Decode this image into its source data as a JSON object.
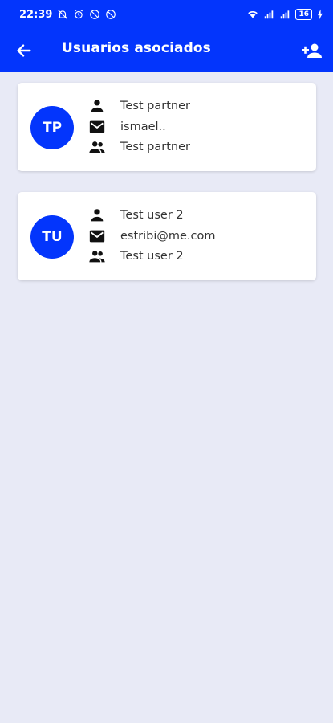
{
  "status": {
    "time": "22:39",
    "battery": "16"
  },
  "appbar": {
    "title": "Usuarios asociados"
  },
  "users": [
    {
      "initials": "TP",
      "name": "Test partner",
      "email": "ismael..",
      "group": "Test partner"
    },
    {
      "initials": "TU",
      "name": "Test user 2",
      "email": "estribi@me.com",
      "group": "Test user 2"
    }
  ],
  "colors": {
    "primary": "#0335fc",
    "background": "#e8eaf6"
  },
  "icons": {
    "back": "arrow-left-icon",
    "add": "person-add-icon",
    "name": "person-icon",
    "email": "mail-icon",
    "group": "group-icon"
  }
}
